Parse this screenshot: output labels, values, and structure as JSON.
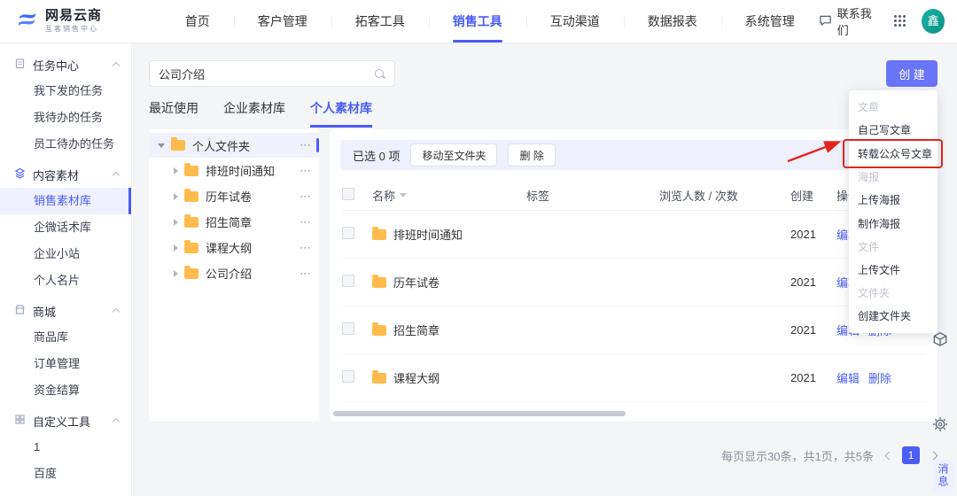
{
  "colors": {
    "accent": "#4a5df5",
    "create_button": "#6a74f6",
    "annotation_red": "#e2241c",
    "folder_yellow": "#ffbb4d",
    "avatar_teal": "#12a79c",
    "toolbar_bg": "#eef1fc"
  },
  "topnav": {
    "brand": {
      "title": "网易云商",
      "subtitle": "互客销售中心"
    },
    "items": [
      {
        "label": "首页"
      },
      {
        "label": "客户管理"
      },
      {
        "label": "拓客工具"
      },
      {
        "label": "销售工具",
        "active": true
      },
      {
        "label": "互动渠道"
      },
      {
        "label": "数据报表"
      },
      {
        "label": "系统管理"
      }
    ],
    "contact_label": "联系我们",
    "avatar_text": "鑫"
  },
  "sidebar": {
    "groups": [
      {
        "label": "任务中心",
        "icon": "clipboard-icon",
        "items": [
          {
            "label": "我下发的任务"
          },
          {
            "label": "我待办的任务"
          },
          {
            "label": "员工待办的任务"
          }
        ]
      },
      {
        "label": "内容素材",
        "icon": "layers-icon",
        "items": [
          {
            "label": "销售素材库",
            "active": true
          },
          {
            "label": "企微话术库"
          },
          {
            "label": "企业小站"
          },
          {
            "label": "个人名片"
          }
        ]
      },
      {
        "label": "商城",
        "icon": "shop-icon",
        "items": [
          {
            "label": "商品库"
          },
          {
            "label": "订单管理"
          },
          {
            "label": "资金结算"
          }
        ]
      },
      {
        "label": "自定义工具",
        "icon": "tools-icon",
        "items": [
          {
            "label": "1"
          },
          {
            "label": "百度"
          }
        ]
      }
    ]
  },
  "content": {
    "search": {
      "value": "公司介绍"
    },
    "create_button_label": "创 建",
    "tabs": [
      {
        "label": "最近使用"
      },
      {
        "label": "企业素材库"
      },
      {
        "label": "个人素材库",
        "active": true
      }
    ],
    "tree": {
      "root": {
        "label": "个人文件夹"
      },
      "items": [
        {
          "label": "排班时间通知"
        },
        {
          "label": "历年试卷"
        },
        {
          "label": "招生简章"
        },
        {
          "label": "课程大纲"
        },
        {
          "label": "公司介绍"
        }
      ]
    },
    "toolbar": {
      "selected_text": "已选 0 项",
      "move_button": "移动至文件夹",
      "delete_button": "删 除"
    },
    "table": {
      "headers": {
        "name": "名称",
        "tag": "标签",
        "views": "浏览人数 / 次数",
        "created": "创建",
        "actions": "操作"
      },
      "rows": [
        {
          "name": "排班时间通知",
          "created": "2021",
          "edit": "编辑",
          "delete": "删除"
        },
        {
          "name": "历年试卷",
          "created": "2021",
          "edit": "编辑",
          "delete": "删除"
        },
        {
          "name": "招生简章",
          "created": "2021",
          "edit": "编辑",
          "delete": "删除"
        },
        {
          "name": "课程大纲",
          "created": "2021",
          "edit": "编辑",
          "delete": "删除"
        }
      ]
    },
    "pagination": {
      "summary": "每页显示30条，共1页，共5条",
      "page": "1"
    }
  },
  "dropdown": {
    "sections": [
      {
        "label": "文章",
        "items": [
          {
            "label": "自己写文章"
          },
          {
            "label": "转载公众号文章",
            "highlighted": true
          }
        ]
      },
      {
        "label": "海报",
        "items": [
          {
            "label": "上传海报"
          },
          {
            "label": "制作海报"
          }
        ]
      },
      {
        "label": "文件",
        "items": [
          {
            "label": "上传文件"
          }
        ]
      },
      {
        "label": "文件夹",
        "items": [
          {
            "label": "创建文件夹"
          }
        ]
      }
    ]
  },
  "floating": {
    "message_label": "消息"
  }
}
